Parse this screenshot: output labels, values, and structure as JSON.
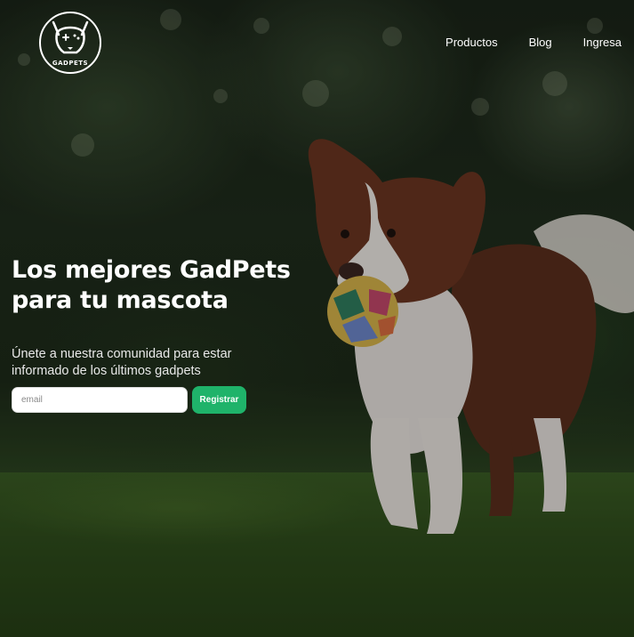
{
  "brand": {
    "name": "GADPETS",
    "logo_icon": "dog-gamepad-icon"
  },
  "nav": {
    "items": [
      {
        "label": "Productos"
      },
      {
        "label": "Blog"
      },
      {
        "label": "Ingresa"
      }
    ]
  },
  "hero": {
    "title_line1": "Los mejores GadPets",
    "title_line2": "para tu mascota",
    "subtitle": "Únete a nuestra comunidad para estar informado de los últimos gadpets",
    "background_image": "dog-with-ball-in-grass"
  },
  "signup": {
    "email_placeholder": "email",
    "email_value": "",
    "button_label": "Registrar"
  },
  "colors": {
    "accent": "#1fb36a",
    "text": "#ffffff"
  }
}
